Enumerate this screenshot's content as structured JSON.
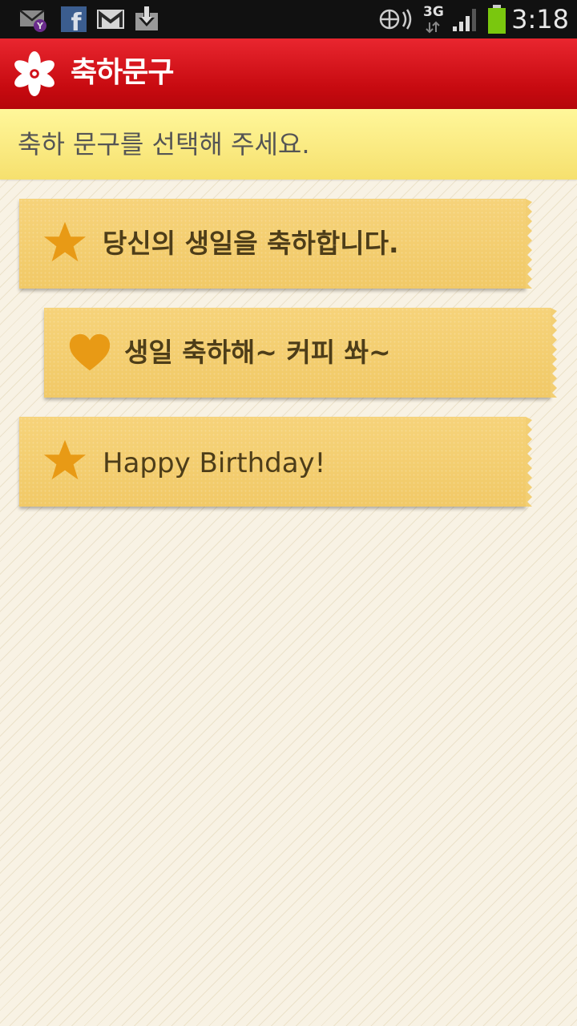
{
  "status_bar": {
    "time": "3:18",
    "network": "3G",
    "notification_icons": [
      "yahoo-mail-icon",
      "facebook-icon",
      "gmail-icon",
      "download-icon"
    ],
    "system_icons": [
      "data-sync-icon",
      "signal-icon",
      "battery-icon"
    ],
    "battery_color": "#7ac70e"
  },
  "app_bar": {
    "title": "축하문구",
    "logo_icon": "flower-logo-icon",
    "color": "#d0111a"
  },
  "banner": {
    "text": "축하 문구를 선택해 주세요.",
    "color": "#fbeb84"
  },
  "messages": [
    {
      "icon": "star-icon",
      "text": "당신의 생일을 축하합니다."
    },
    {
      "icon": "heart-icon",
      "text": "생일 축하해~ 커피 쏴~"
    },
    {
      "icon": "star-icon",
      "text": "Happy Birthday!"
    }
  ],
  "colors": {
    "card": "#f3cf73",
    "icon_accent": "#e89a15",
    "card_text": "#4d3d19"
  }
}
